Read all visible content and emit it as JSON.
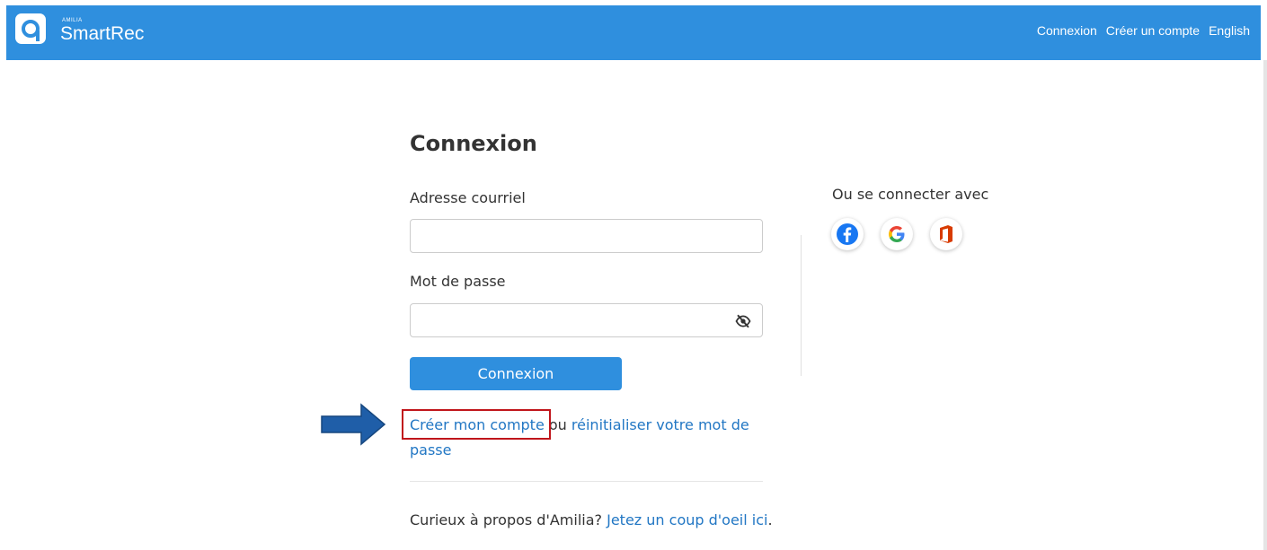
{
  "header": {
    "brand_small": "AMILIA",
    "brand": "SmartRec",
    "nav": [
      "Connexion",
      "Créer un compte",
      "English"
    ],
    "color": "#2f8fde"
  },
  "login": {
    "title": "Connexion",
    "email_label": "Adresse courriel",
    "email_value": "",
    "password_label": "Mot de passe",
    "password_value": "",
    "submit_label": "Connexion"
  },
  "links": {
    "create_account": "Créer mon compte",
    "or": " ou ",
    "reset_password": "réinitialiser votre mot de passe"
  },
  "about": {
    "text": "Curieux à propos d'Amilia? ",
    "link": "Jetez un coup d'oeil ici",
    "end": "."
  },
  "social": {
    "title": "Ou se connecter avec",
    "providers": [
      "facebook-icon",
      "google-icon",
      "office-icon"
    ]
  },
  "annotation": {
    "highlight_color": "#c0151b",
    "arrow_color": "#1f5ea8"
  }
}
